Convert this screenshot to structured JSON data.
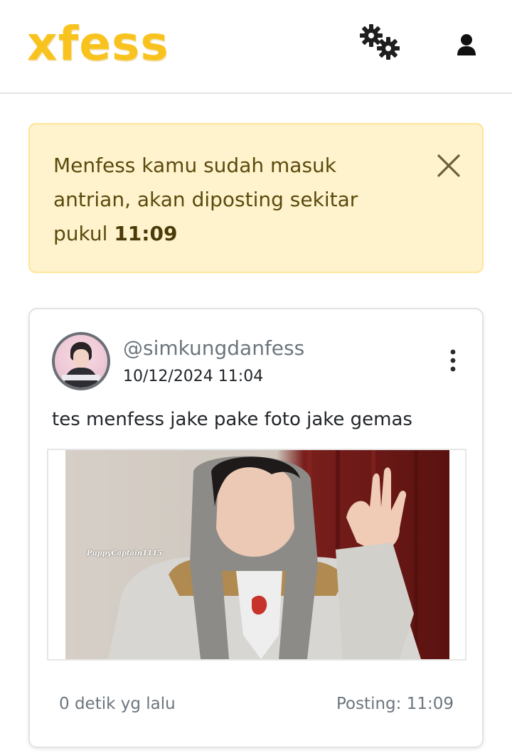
{
  "header": {
    "logo": "xfess",
    "settings_icon": "gears-icon",
    "profile_icon": "user-icon"
  },
  "alert": {
    "message_prefix": "Menfess kamu sudah masuk antrian, akan diposting sekitar pukul",
    "time": "11:09",
    "close_icon": "close-icon"
  },
  "post": {
    "username": "@simkungdanfess",
    "timestamp": "10/12/2024 11:04",
    "text": "tes menfess jake pake foto jake gemas",
    "image_watermark": "PuppyCaptain1115",
    "relative_time": "0 detik yg lalu",
    "posting_label": "Posting: 11:09",
    "menu_icon": "more-vertical-icon"
  },
  "colors": {
    "brand": "#f9c31f",
    "alert_bg": "#fff3cd",
    "alert_border": "#ffe49a",
    "alert_text": "#5b4a0d",
    "muted": "#6c757d"
  }
}
